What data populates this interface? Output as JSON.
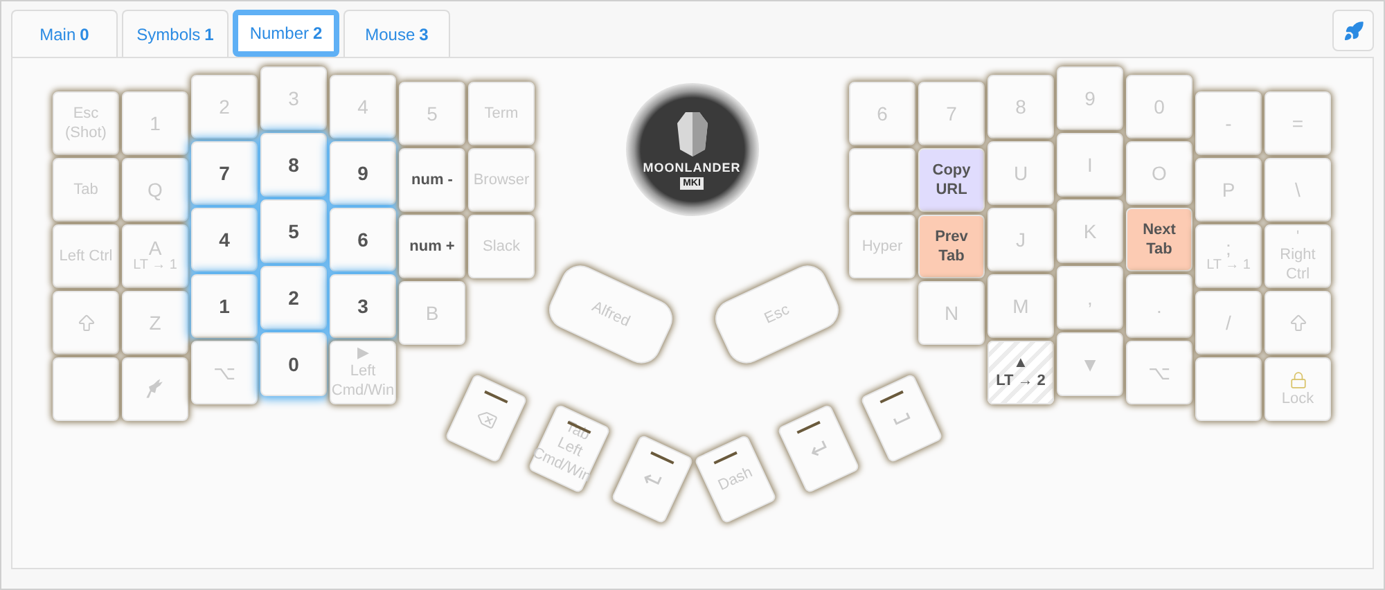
{
  "tabs": [
    {
      "label": "Main",
      "number": "0",
      "selected": false
    },
    {
      "label": "Symbols",
      "number": "1",
      "selected": false
    },
    {
      "label": "Number",
      "number": "2",
      "selected": true
    },
    {
      "label": "Mouse",
      "number": "3",
      "selected": false
    }
  ],
  "left_half": {
    "columns": [
      {
        "keys": [
          {
            "label": "Esc (Shot)",
            "dim": true
          },
          {
            "label": "Tab",
            "dim": true
          },
          {
            "label": "Left Ctrl",
            "dim": true
          },
          {
            "kind": "shift",
            "dim": true
          },
          {
            "kind": "blank"
          }
        ]
      },
      {
        "keys": [
          {
            "label": "1",
            "dim": true
          },
          {
            "label": "Q",
            "dim": true
          },
          {
            "label": "A",
            "sub": "LT → 1",
            "dim": true
          },
          {
            "label": "Z",
            "dim": true
          },
          {
            "kind": "animal",
            "dim": true
          }
        ]
      },
      {
        "keys": [
          {
            "label": "2",
            "dim": true
          },
          {
            "label": "7",
            "dim": false,
            "glow": true
          },
          {
            "label": "4",
            "dim": false,
            "glow": true
          },
          {
            "label": "1",
            "dim": false,
            "glow": true
          },
          {
            "label": "⌥",
            "dim": true
          }
        ]
      },
      {
        "keys": [
          {
            "label": "3",
            "dim": true
          },
          {
            "label": "8",
            "dim": false,
            "glow": true
          },
          {
            "label": "5",
            "dim": false,
            "glow": true
          },
          {
            "label": "2",
            "dim": false,
            "glow": true
          },
          {
            "label": "0",
            "dim": false,
            "glow": true
          }
        ]
      },
      {
        "keys": [
          {
            "label": "4",
            "dim": true
          },
          {
            "label": "9",
            "dim": false,
            "glow": true
          },
          {
            "label": "6",
            "dim": false,
            "glow": true
          },
          {
            "label": "3",
            "dim": false,
            "glow": true
          },
          {
            "top": "▶",
            "label": "Left Cmd/Win",
            "dim": true
          }
        ]
      },
      {
        "keys": [
          {
            "label": "5",
            "dim": true
          },
          {
            "label": "num -",
            "dim": false
          },
          {
            "label": "num +",
            "dim": false
          },
          {
            "label": "B",
            "dim": true
          }
        ]
      },
      {
        "keys": [
          {
            "label": "Term",
            "dim": true
          },
          {
            "label": "Browser",
            "dim": true
          },
          {
            "label": "Slack",
            "dim": true
          }
        ]
      }
    ]
  },
  "logo": {
    "title": "MOONLANDER",
    "badge": "MKI"
  },
  "right_half": {
    "columns": [
      {
        "keys": [
          {
            "label": "6",
            "dim": true
          },
          {
            "kind": "blank"
          },
          {
            "label": "Hyper",
            "dim": true
          }
        ]
      },
      {
        "keys": [
          {
            "label": "7",
            "dim": true
          },
          {
            "label": "Copy URL",
            "dim": false,
            "color": "#e0dcfd"
          },
          {
            "label": "Prev Tab",
            "dim": false,
            "color": "#fccbb3"
          },
          {
            "label": "N",
            "dim": true
          }
        ]
      },
      {
        "keys": [
          {
            "label": "8",
            "dim": true
          },
          {
            "label": "U",
            "dim": true
          },
          {
            "label": "J",
            "dim": true
          },
          {
            "label": "M",
            "dim": true
          },
          {
            "top": "▲",
            "label": "LT → 2",
            "dim": false,
            "held": true
          }
        ]
      },
      {
        "keys": [
          {
            "label": "9",
            "dim": true
          },
          {
            "label": "I",
            "dim": true
          },
          {
            "label": "K",
            "dim": true
          },
          {
            "label": ",",
            "dim": true
          },
          {
            "label": "▼",
            "dim": true
          }
        ]
      },
      {
        "keys": [
          {
            "label": "0",
            "dim": true
          },
          {
            "label": "O",
            "dim": true
          },
          {
            "label": "Next Tab",
            "dim": false,
            "color": "#fccbb3"
          },
          {
            "label": ".",
            "dim": true
          },
          {
            "label": "⌥",
            "dim": true
          }
        ]
      },
      {
        "keys": [
          {
            "label": "-",
            "dim": true
          },
          {
            "label": "P",
            "dim": true
          },
          {
            "label": ";",
            "sub": "LT → 1",
            "dim": true
          },
          {
            "label": "/",
            "dim": true
          },
          {
            "kind": "blank"
          }
        ]
      },
      {
        "keys": [
          {
            "label": "=",
            "dim": true
          },
          {
            "label": "\\",
            "dim": true
          },
          {
            "top": "'",
            "label": "Right Ctrl",
            "dim": true
          },
          {
            "kind": "shift",
            "dim": true
          },
          {
            "kind": "lock",
            "label": "Lock",
            "dim": true
          }
        ]
      }
    ]
  },
  "left_thumb": {
    "large_key": {
      "label": "Alfred",
      "dim": true
    },
    "keys": [
      {
        "kind": "backspace",
        "dim": true,
        "marked": true
      },
      {
        "top": "Tab",
        "label": "Left Cmd/Win",
        "dim": true,
        "marked": true
      },
      {
        "kind": "enter",
        "dim": true,
        "marked": true
      }
    ]
  },
  "right_thumb": {
    "large_key": {
      "label": "Esc",
      "dim": true
    },
    "keys": [
      {
        "label": "Dash",
        "dim": true,
        "marked": true
      },
      {
        "kind": "enter",
        "dim": true,
        "marked": true
      },
      {
        "kind": "space",
        "dim": true,
        "marked": true
      }
    ]
  }
}
